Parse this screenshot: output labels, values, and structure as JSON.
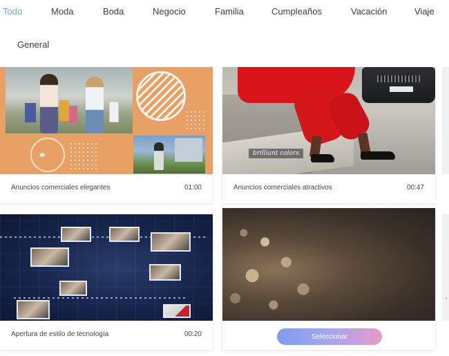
{
  "tabs": [
    {
      "label": "Todo",
      "active": true
    },
    {
      "label": "Moda",
      "active": false
    },
    {
      "label": "Boda",
      "active": false
    },
    {
      "label": "Negocio",
      "active": false
    },
    {
      "label": "Familia",
      "active": false
    },
    {
      "label": "Cumpleaños",
      "active": false
    },
    {
      "label": "Vacación",
      "active": false
    },
    {
      "label": "Viaje",
      "active": false
    },
    {
      "label": "General",
      "active": false
    }
  ],
  "cards": [
    {
      "title": "Anuncios comerciales elegantes",
      "duration": "01:00"
    },
    {
      "title": "Anuncios comerciales atractivos",
      "duration": "00:47",
      "overlay_text": "brilliant colors"
    },
    {
      "title": "Apertura de estilo de tecnología",
      "duration": "00:20"
    },
    {
      "select_label": "Seleccionar"
    }
  ],
  "colors": {
    "active_tab": "#6fa6e6",
    "select_gradient_start": "#7d9df0",
    "select_gradient_end": "#e79ac8"
  }
}
